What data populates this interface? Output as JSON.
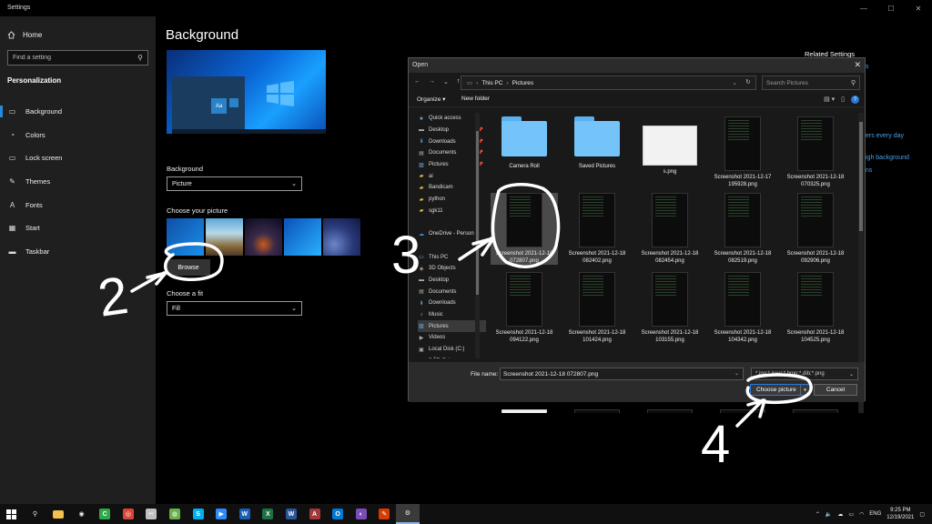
{
  "settings": {
    "window_title": "Settings",
    "home": "Home",
    "search_placeholder": "Find a setting",
    "section": "Personalization",
    "nav": [
      {
        "label": "Background",
        "icon": "image-icon"
      },
      {
        "label": "Colors",
        "icon": "palette-icon"
      },
      {
        "label": "Lock screen",
        "icon": "monitor-icon"
      },
      {
        "label": "Themes",
        "icon": "brush-icon"
      },
      {
        "label": "Fonts",
        "icon": "font-icon"
      },
      {
        "label": "Start",
        "icon": "start-icon"
      },
      {
        "label": "Taskbar",
        "icon": "taskbar-icon"
      }
    ],
    "page_title": "Background",
    "preview_tile_text": "Aa",
    "background_label": "Background",
    "background_value": "Picture",
    "choose_picture_label": "Choose your picture",
    "browse": "Browse",
    "choose_fit_label": "Choose a fit",
    "fit_value": "Fill",
    "related_settings": "Related Settings",
    "partial_links": [
      "s",
      "ers every day",
      "igh background",
      "ns"
    ]
  },
  "dialog": {
    "title": "Open",
    "breadcrumb": [
      "This PC",
      "Pictures"
    ],
    "search_placeholder": "Search Pictures",
    "organize": "Organize ▾",
    "new_folder": "New folder",
    "nav_pane": [
      {
        "label": "Quick access",
        "icon": "star-icon",
        "pinned": false
      },
      {
        "label": "Desktop",
        "icon": "desktop-icon",
        "pinned": true
      },
      {
        "label": "Downloads",
        "icon": "download-icon",
        "pinned": true
      },
      {
        "label": "Documents",
        "icon": "document-icon",
        "pinned": true
      },
      {
        "label": "Pictures",
        "icon": "pictures-icon",
        "pinned": true
      },
      {
        "label": "ai",
        "icon": "folder-icon",
        "pinned": false
      },
      {
        "label": "Bandicam",
        "icon": "folder-icon",
        "pinned": false
      },
      {
        "label": "python",
        "icon": "folder-icon",
        "pinned": false
      },
      {
        "label": "sgk11",
        "icon": "folder-icon",
        "pinned": false
      },
      {
        "label": "",
        "icon": "",
        "pinned": false
      },
      {
        "label": "OneDrive - Person",
        "icon": "cloud-icon",
        "pinned": false
      },
      {
        "label": "",
        "icon": "",
        "pinned": false
      },
      {
        "label": "This PC",
        "icon": "pc-icon",
        "pinned": false
      },
      {
        "label": "3D Objects",
        "icon": "cube-icon",
        "pinned": false
      },
      {
        "label": "Desktop",
        "icon": "desktop-icon",
        "pinned": false
      },
      {
        "label": "Documents",
        "icon": "document-icon",
        "pinned": false
      },
      {
        "label": "Downloads",
        "icon": "download-icon",
        "pinned": false
      },
      {
        "label": "Music",
        "icon": "music-icon",
        "pinned": false
      },
      {
        "label": "Pictures",
        "icon": "pictures-icon",
        "pinned": false
      },
      {
        "label": "Videos",
        "icon": "video-icon",
        "pinned": false
      },
      {
        "label": "Local Disk (C:)",
        "icon": "disk-icon",
        "pinned": false
      },
      {
        "label": "ĐẤT (D:)",
        "icon": "disk-icon",
        "pinned": false
      }
    ],
    "files": [
      {
        "name": "Camera Roll",
        "kind": "folder"
      },
      {
        "name": "Saved Pictures",
        "kind": "folder"
      },
      {
        "name": "s.png",
        "kind": "white"
      },
      {
        "name": "Screenshot 2021-12-17 195928.png",
        "kind": "dark"
      },
      {
        "name": "Screenshot 2021-12-18 070325.png",
        "kind": "dark"
      },
      {
        "name": "Screenshot 2021-12-18 072807.png",
        "kind": "dark"
      },
      {
        "name": "Screenshot 2021-12-18 082402.png",
        "kind": "dark"
      },
      {
        "name": "Screenshot 2021-12-18 082454.png",
        "kind": "dark"
      },
      {
        "name": "Screenshot 2021-12-18 082519.png",
        "kind": "dark"
      },
      {
        "name": "Screenshot 2021-12-18 092906.png",
        "kind": "dark"
      },
      {
        "name": "Screenshot 2021-12-18 094122.png",
        "kind": "dark"
      },
      {
        "name": "Screenshot 2021-12-18 101424.png",
        "kind": "dark"
      },
      {
        "name": "Screenshot 2021-12-18 103155.png",
        "kind": "dark"
      },
      {
        "name": "Screenshot 2021-12-18 104342.png",
        "kind": "dark"
      },
      {
        "name": "Screenshot 2021-12-18 104525.png",
        "kind": "dark"
      }
    ],
    "file_name_label": "File name:",
    "file_name_value": "Screenshot 2021-12-18 072807.png",
    "file_type": "*.jpg;*.jpeg;*.bmp;*.dib;*.png",
    "choose_picture": "Choose picture",
    "cancel": "Cancel"
  },
  "annotations": [
    "2",
    "3",
    "4"
  ],
  "taskbar": {
    "apps": [
      {
        "name": "windows-start-icon",
        "glyph": "",
        "color": "#ffffff"
      },
      {
        "name": "search-icon",
        "glyph": "⚲",
        "color": ""
      },
      {
        "name": "file-explorer-icon",
        "glyph": "",
        "color": "#f2c14e"
      },
      {
        "name": "github-icon",
        "glyph": "◉",
        "color": ""
      },
      {
        "name": "camtasia-icon",
        "glyph": "C",
        "color": "#2ea84a"
      },
      {
        "name": "chrome-icon",
        "glyph": "◎",
        "color": "#db4437"
      },
      {
        "name": "snip-icon",
        "glyph": "✂",
        "color": "#c0c0c0"
      },
      {
        "name": "green-app-icon",
        "glyph": "◍",
        "color": "#6ab04c"
      },
      {
        "name": "skype-icon",
        "glyph": "S",
        "color": "#00aff0"
      },
      {
        "name": "zoom-icon",
        "glyph": "▶",
        "color": "#2d8cff"
      },
      {
        "name": "word-blue-icon",
        "glyph": "W",
        "color": "#1a5fb4"
      },
      {
        "name": "excel-icon",
        "glyph": "X",
        "color": "#1e7145"
      },
      {
        "name": "word-icon",
        "glyph": "W",
        "color": "#2b579a"
      },
      {
        "name": "access-icon",
        "glyph": "A",
        "color": "#a4373a"
      },
      {
        "name": "outlook-icon",
        "glyph": "O",
        "color": "#0078d4"
      },
      {
        "name": "github-desktop-icon",
        "glyph": "◐",
        "color": "#7b4db8"
      },
      {
        "name": "paint-icon",
        "glyph": "✎",
        "color": "#d83b01"
      },
      {
        "name": "settings-icon",
        "glyph": "⚙",
        "color": ""
      }
    ],
    "language": "ENG",
    "time": "9:25 PM",
    "date": "12/19/2021"
  }
}
